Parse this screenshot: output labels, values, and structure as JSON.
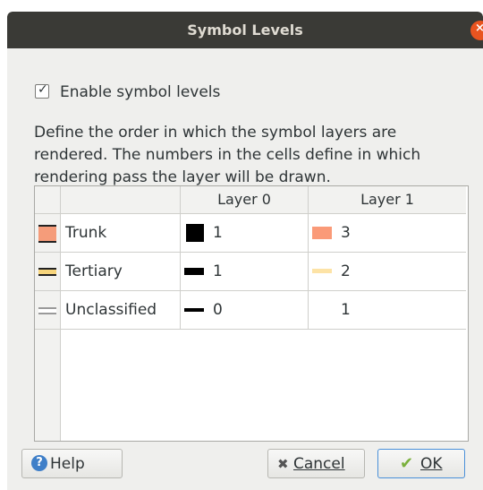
{
  "dialog": {
    "title": "Symbol Levels",
    "close_icon": "×"
  },
  "enable_checkbox": {
    "checked": true,
    "check_glyph": "✓",
    "label": "Enable symbol levels"
  },
  "description": [
    "Define the order in which the symbol layers are",
    "rendered. The numbers in the cells define in which",
    "rendering pass the layer will be drawn."
  ],
  "table": {
    "columns": [
      "Layer 0",
      "Layer 1"
    ],
    "rows": [
      {
        "name": "Trunk",
        "icon": "trunk-road-icon",
        "layer0": {
          "value": "1",
          "swatch": "#000000"
        },
        "layer1": {
          "value": "3",
          "swatch": "#fa9a78"
        }
      },
      {
        "name": "Tertiary",
        "icon": "tertiary-road-icon",
        "layer0": {
          "value": "1",
          "swatch": "#000000"
        },
        "layer1": {
          "value": "2",
          "swatch": "#fde3a6"
        }
      },
      {
        "name": "Unclassified",
        "icon": "unclassified-road-icon",
        "layer0": {
          "value": "0",
          "swatch": "#000000"
        },
        "layer1": {
          "value": "1",
          "swatch": "#ffffff"
        }
      }
    ]
  },
  "buttons": {
    "help": "Help",
    "help_icon_glyph": "?",
    "cancel": "Cancel",
    "cancel_icon_glyph": "✖",
    "ok": "OK",
    "ok_icon_glyph": "✔"
  }
}
